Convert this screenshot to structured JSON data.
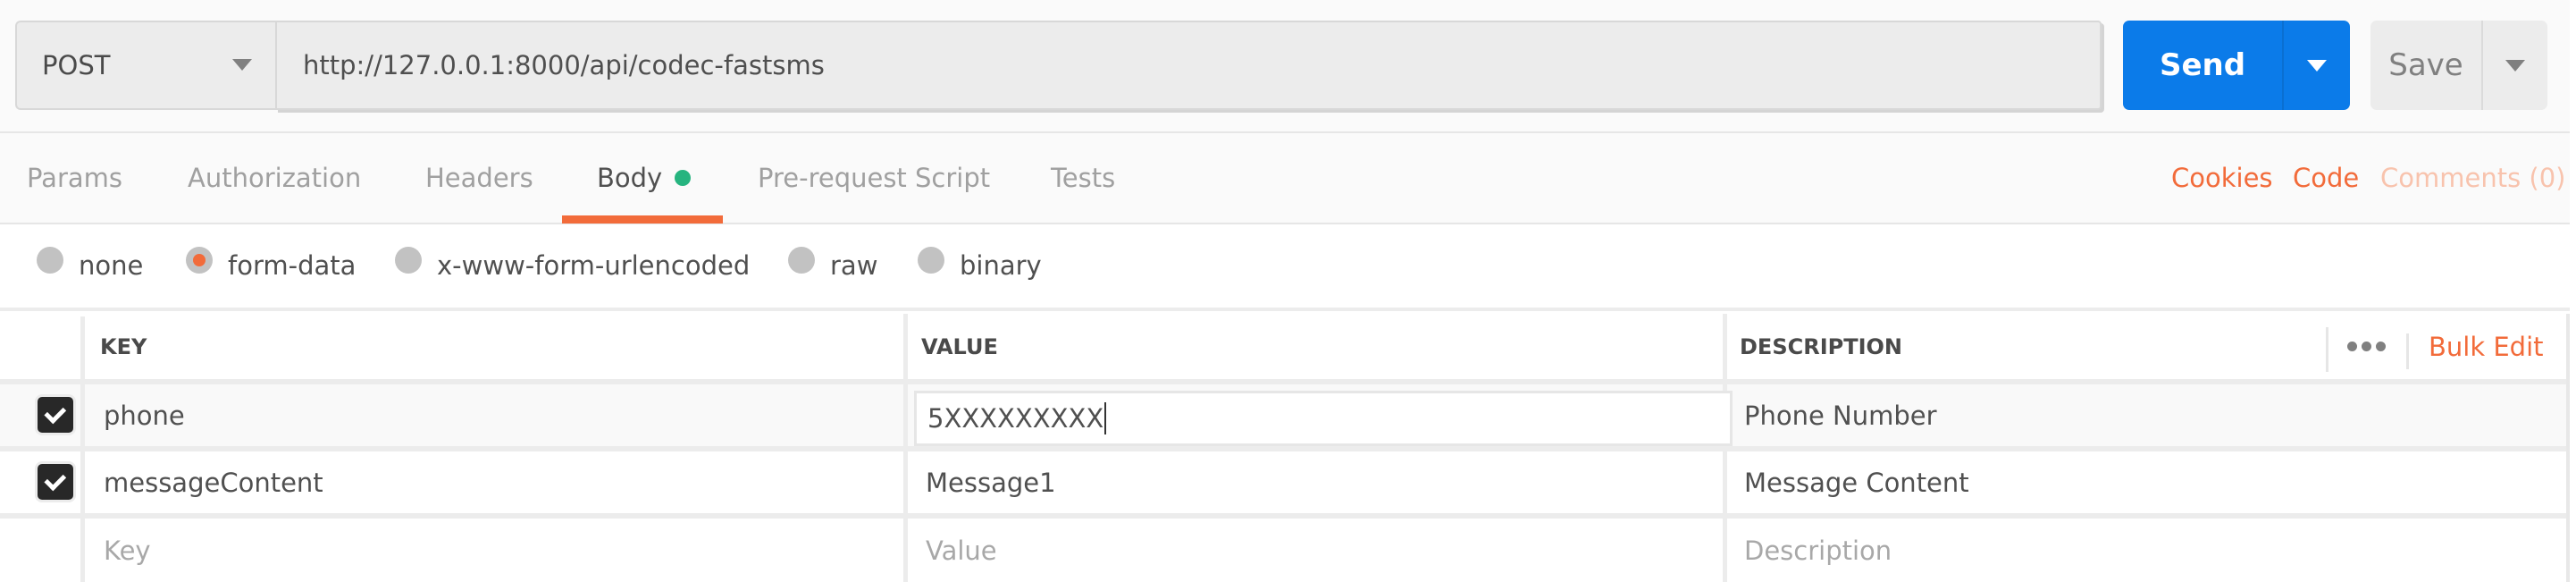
{
  "request": {
    "method": "POST",
    "url": "http://127.0.0.1:8000/api/codec-fastsms",
    "send_label": "Send",
    "save_label": "Save"
  },
  "tabs": [
    {
      "label": "Params",
      "active": false
    },
    {
      "label": "Authorization",
      "active": false
    },
    {
      "label": "Headers",
      "active": false
    },
    {
      "label": "Body",
      "active": true,
      "indicator": "green-dot"
    },
    {
      "label": "Pre-request Script",
      "active": false
    },
    {
      "label": "Tests",
      "active": false
    }
  ],
  "right_links": {
    "cookies": "Cookies",
    "code": "Code",
    "comments": "Comments (0)"
  },
  "body_types": [
    {
      "label": "none",
      "selected": false
    },
    {
      "label": "form-data",
      "selected": true
    },
    {
      "label": "x-www-form-urlencoded",
      "selected": false
    },
    {
      "label": "raw",
      "selected": false
    },
    {
      "label": "binary",
      "selected": false
    }
  ],
  "table": {
    "headers": {
      "key": "KEY",
      "value": "VALUE",
      "description": "DESCRIPTION"
    },
    "bulk_edit": "Bulk Edit",
    "more_icon": "ellipsis-icon",
    "rows": [
      {
        "checked": true,
        "key": "phone",
        "value": "5XXXXXXXXX",
        "description": "Phone Number",
        "editing": "value"
      },
      {
        "checked": true,
        "key": "messageContent",
        "value": "Message1",
        "description": "Message Content"
      }
    ],
    "placeholders": {
      "key": "Key",
      "value": "Value",
      "description": "Description"
    }
  },
  "colors": {
    "accent": "#f26b3a",
    "send": "#0b7be9",
    "body_indicator": "#26b47f"
  }
}
